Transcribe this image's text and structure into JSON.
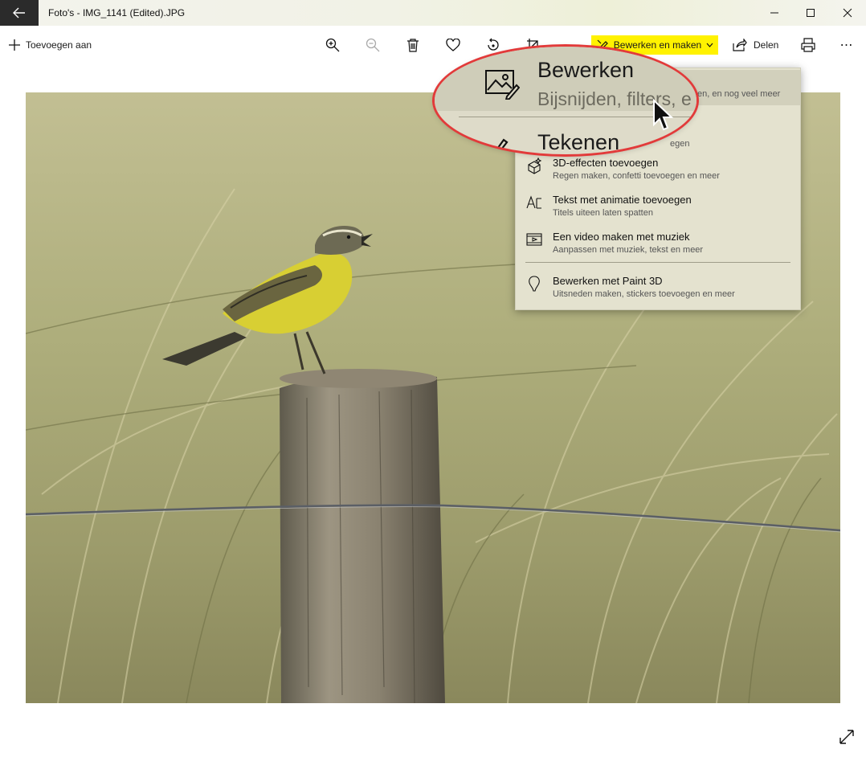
{
  "window": {
    "title": "Foto's - IMG_1141 (Edited).JPG"
  },
  "toolbar": {
    "add_to_label": "Toevoegen aan",
    "edit_create_label": "Bewerken en maken",
    "share_label": "Delen",
    "more_label": "⋯"
  },
  "menu": {
    "items": [
      {
        "title": "Bewerken",
        "subtitle": "Bijsnijden, filters, effecten, en nog veel meer"
      },
      {
        "title": "Tekenen",
        "subtitle": "Tekenen op foto's en video's vastleggen"
      },
      {
        "title": "3D-effecten toevoegen",
        "subtitle": "Regen maken, confetti toevoegen en meer"
      },
      {
        "title": "Tekst met animatie toevoegen",
        "subtitle": "Titels uiteen laten spatten"
      },
      {
        "title": "Een video maken met muziek",
        "subtitle": "Aanpassen met muziek, tekst en meer"
      },
      {
        "title": "Bewerken met Paint 3D",
        "subtitle": "Uitsneden maken, stickers toevoegen en meer"
      }
    ],
    "visible_fragments": {
      "edit_sub_tail": "en, en nog veel meer",
      "draw_sub_tail": "egen"
    }
  },
  "magnifier": {
    "title": "Bewerken",
    "subtitle": "Bijsnijden, filters, e",
    "title2": "Tekenen"
  },
  "colors": {
    "highlight_yellow": "#fff200",
    "callout_red": "#e23a3a",
    "menu_bg": "#e4e2cf"
  },
  "icons": [
    "back-arrow-icon",
    "minimize-icon",
    "maximize-icon",
    "close-icon",
    "plus-icon",
    "zoom-in-icon",
    "zoom-out-icon",
    "trash-icon",
    "heart-icon",
    "rotate-icon",
    "crop-icon",
    "pen-sparkle-icon",
    "chevron-down-icon",
    "share-icon",
    "printer-icon",
    "more-icon",
    "expand-icon"
  ]
}
